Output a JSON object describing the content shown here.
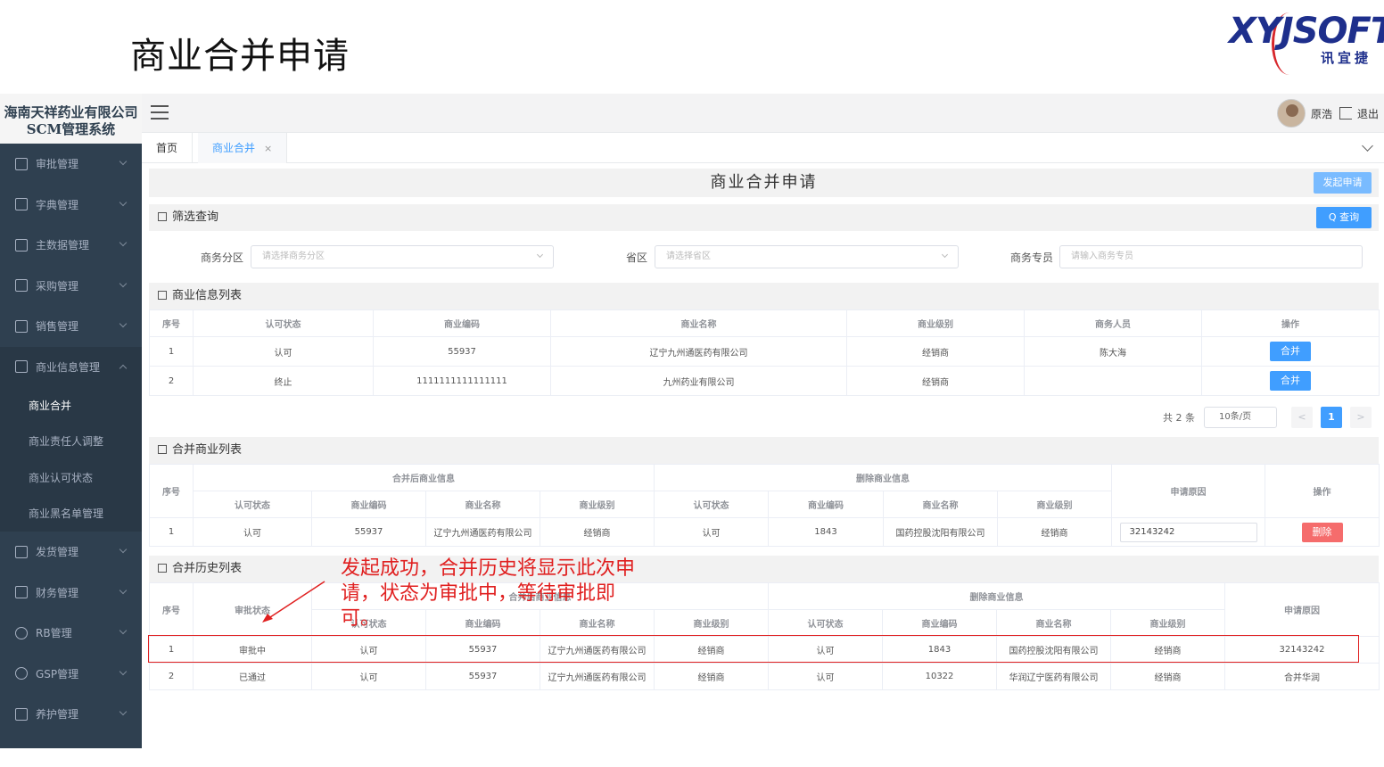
{
  "slide": {
    "title": "商业合并申请"
  },
  "logo": {
    "brand": "XYJSOFT",
    "sub": "讯宜捷"
  },
  "system": {
    "title": "海南天祥药业有限公司SCM管理系统"
  },
  "sidebar": {
    "items": [
      {
        "label": "审批管理"
      },
      {
        "label": "字典管理"
      },
      {
        "label": "主数据管理"
      },
      {
        "label": "采购管理"
      },
      {
        "label": "销售管理"
      },
      {
        "label": "商业信息管理"
      },
      {
        "label": "发货管理"
      },
      {
        "label": "财务管理"
      },
      {
        "label": "RB管理"
      },
      {
        "label": "GSP管理"
      },
      {
        "label": "养护管理"
      }
    ],
    "subitems": [
      {
        "label": "商业合并"
      },
      {
        "label": "商业责任人调整"
      },
      {
        "label": "商业认可状态"
      },
      {
        "label": "商业黑名单管理"
      }
    ]
  },
  "topbar": {
    "user_name": "原浩",
    "logout": "退出"
  },
  "tabs": [
    {
      "label": "首页"
    },
    {
      "label": "商业合并",
      "close": "×"
    }
  ],
  "page": {
    "title": "商业合并申请",
    "submit_button": "发起申请"
  },
  "filter": {
    "heading": "筛选查询",
    "query_button": "Q 查询",
    "region_label": "商务分区",
    "region_placeholder": "请选择商务分区",
    "province_label": "省区",
    "province_placeholder": "请选择省区",
    "rep_label": "商务专员",
    "rep_placeholder": "请输入商务专员"
  },
  "business_list": {
    "heading": "商业信息列表",
    "columns": [
      "序号",
      "认可状态",
      "商业编码",
      "商业名称",
      "商业级别",
      "商务人员",
      "操作"
    ],
    "rows": [
      [
        "1",
        "认可",
        "55937",
        "辽宁九州通医药有限公司",
        "经销商",
        "陈大海",
        "合并"
      ],
      [
        "2",
        "终止",
        "1111111111111111",
        "九州药业有限公司",
        "经销商",
        "",
        "合并"
      ]
    ],
    "pagination": {
      "total": "共 2 条",
      "page_size": "10条/页",
      "prev": "<",
      "current": "1",
      "next": ">"
    }
  },
  "merge_list": {
    "heading": "合并商业列表",
    "groups": [
      "合并后商业信息",
      "删除商业信息"
    ],
    "col_index": "序号",
    "col_reason": "申请原因",
    "col_action": "操作",
    "subcolumns": [
      "认可状态",
      "商业编码",
      "商业名称",
      "商业级别",
      "认可状态",
      "商业编码",
      "商业名称",
      "商业级别"
    ],
    "rows": [
      {
        "cells": [
          "1",
          "认可",
          "55937",
          "辽宁九州通医药有限公司",
          "经销商",
          "认可",
          "1843",
          "国药控股沈阳有限公司",
          "经销商"
        ],
        "reason": "32143242",
        "action": "删除"
      }
    ]
  },
  "history_list": {
    "heading": "合并历史列表",
    "groups": [
      "合并后商业信息",
      "删除商业信息"
    ],
    "col_index": "序号",
    "col_status": "审批状态",
    "col_reason": "申请原因",
    "subcolumns": [
      "认可状态",
      "商业编码",
      "商业名称",
      "商业级别",
      "认可状态",
      "商业编码",
      "商业名称",
      "商业级别"
    ],
    "rows": [
      [
        "1",
        "审批中",
        "认可",
        "55937",
        "辽宁九州通医药有限公司",
        "经销商",
        "认可",
        "1843",
        "国药控股沈阳有限公司",
        "经销商",
        "32143242"
      ],
      [
        "2",
        "已通过",
        "认可",
        "55937",
        "辽宁九州通医药有限公司",
        "经销商",
        "认可",
        "10322",
        "华润辽宁医药有限公司",
        "经销商",
        "合并华润"
      ]
    ]
  },
  "annotation": {
    "text": "发起成功，合并历史将显示此次申请，状态为审批中，等待审批即可。",
    "color": "#e02020"
  },
  "colors": {
    "primary": "#409eff",
    "danger": "#f56c6c",
    "sidebar": "#2f4050",
    "annotation": "#e02020"
  }
}
